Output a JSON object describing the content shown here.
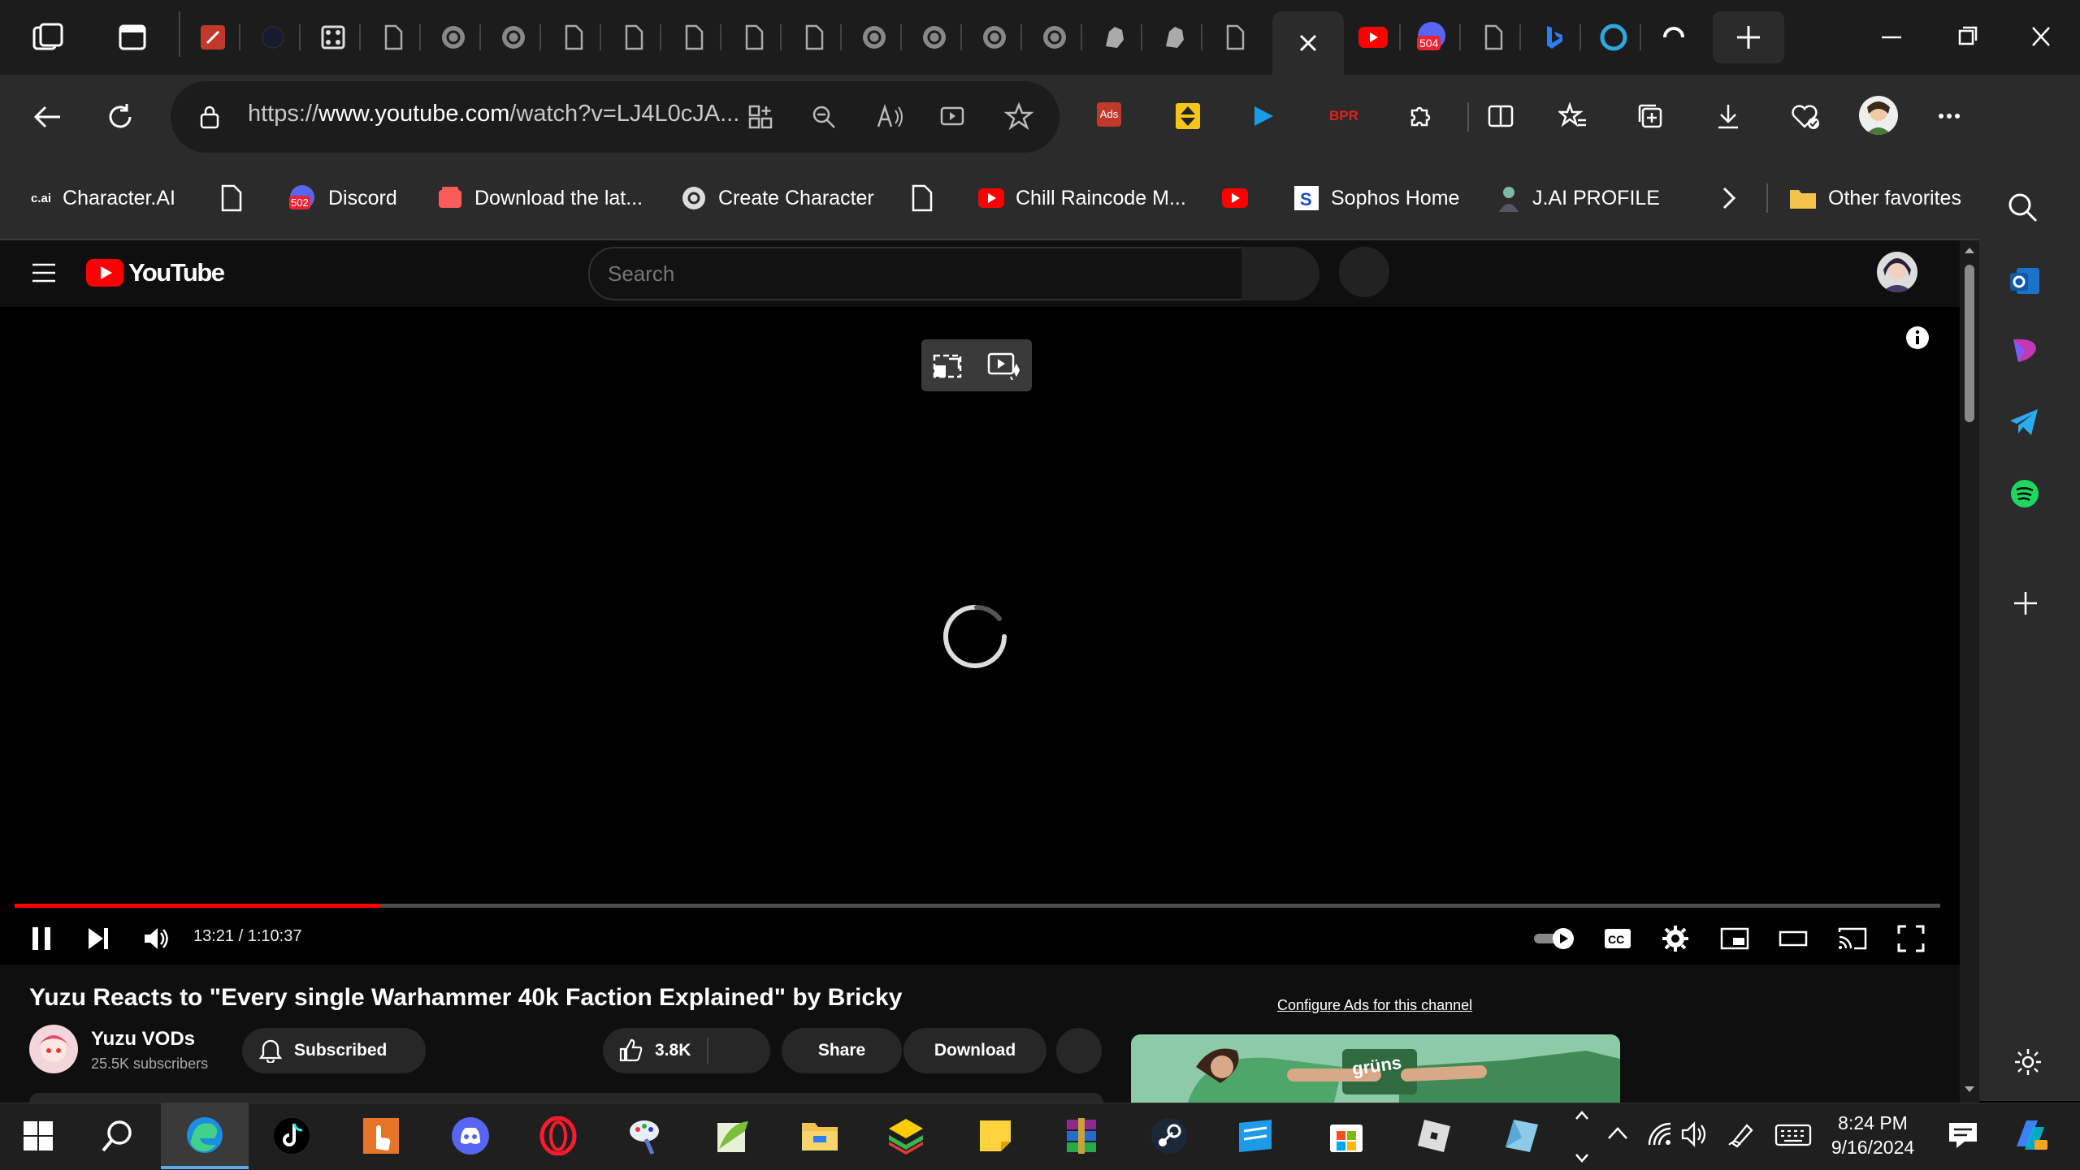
{
  "browser": {
    "address_bar": {
      "url_prefix": "https://",
      "url_domain": "www.youtube.com",
      "url_rest": "/watch?v=LJ4L0cJA..."
    },
    "favorites": [
      {
        "label": "Character.AI",
        "icon": "cai-icon"
      },
      {
        "label": "",
        "icon": "page-icon"
      },
      {
        "label": "Discord",
        "icon": "discord-icon",
        "badge": "502"
      },
      {
        "label": "Download the lat...",
        "icon": "itch-icon"
      },
      {
        "label": "Create Character",
        "icon": "openai-icon"
      },
      {
        "label": "",
        "icon": "page-icon"
      },
      {
        "label": "Chill Raincode M...",
        "icon": "youtube-icon"
      },
      {
        "label": "",
        "icon": "youtube-icon"
      },
      {
        "label": "Sophos Home",
        "icon": "sophos-icon"
      },
      {
        "label": "J.AI PROFILE",
        "icon": "jai-icon"
      }
    ],
    "other_favorites": "Other favorites",
    "tab_badge": "504",
    "extension_label_ads": "Ads",
    "extension_label_bpr": "BPR"
  },
  "youtube": {
    "logo_text": "YouTube",
    "search_placeholder": "Search",
    "player": {
      "time_current": "13:21",
      "time_total": "1:10:37",
      "progress_fraction": 0.19
    },
    "video_title": "Yuzu Reacts to \"Every single Warhammer 40k Faction Explained\" by Bricky",
    "channel_name": "Yuzu VODs",
    "subscribers": "25.5K subscribers",
    "subscribed_label": "Subscribed",
    "likes": "3.8K",
    "share_label": "Share",
    "download_label": "Download",
    "ads_config": "Configure Ads for this channel",
    "ad_can_text": "grüns"
  },
  "taskbar": {
    "time": "8:24 PM",
    "date": "9/16/2024"
  },
  "colors": {
    "youtube_red": "#ff0000",
    "edge_bg": "#2b2b2b",
    "page_bg": "#0f0f0f"
  }
}
